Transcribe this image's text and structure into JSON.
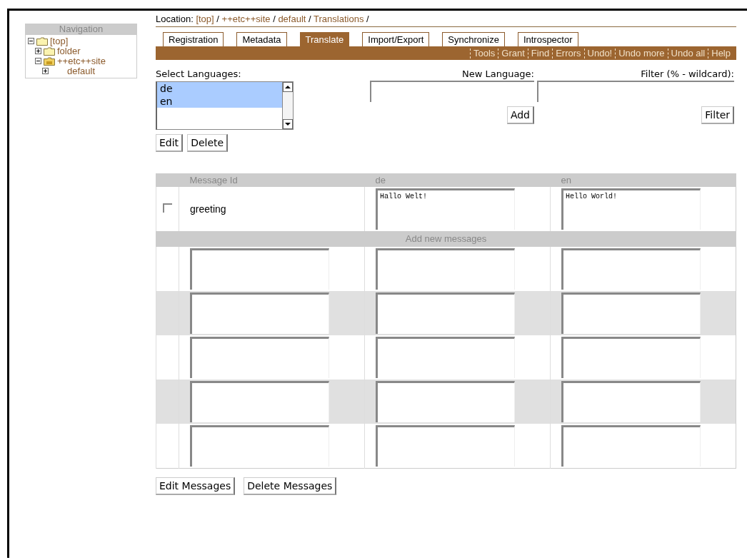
{
  "navigation": {
    "title": "Navigation",
    "tree": [
      {
        "label": "[top]",
        "kind": "folder",
        "expanded": true,
        "children": [
          {
            "label": "folder",
            "kind": "folder",
            "expanded": false
          },
          {
            "label": "++etc++site",
            "kind": "site",
            "expanded": true,
            "children": [
              {
                "label": "default",
                "expanded": false
              }
            ]
          }
        ]
      }
    ]
  },
  "location": {
    "label": "Location:",
    "crumbs": [
      {
        "kind": "link",
        "text": "[top]"
      },
      {
        "kind": "separator",
        "text": "/"
      },
      {
        "kind": "link",
        "text": "++etc++site"
      },
      {
        "kind": "separator",
        "text": "/"
      },
      {
        "kind": "link",
        "text": "default"
      },
      {
        "kind": "separator",
        "text": "/"
      },
      {
        "kind": "link",
        "text": "Translations"
      },
      {
        "kind": "separator",
        "text": "/"
      }
    ]
  },
  "tabs": [
    {
      "label": "Registration",
      "selected": false
    },
    {
      "label": "Metadata",
      "selected": false
    },
    {
      "label": "Translate",
      "selected": true
    },
    {
      "label": "Import/Export",
      "selected": false
    },
    {
      "label": "Synchronize",
      "selected": false
    },
    {
      "label": "Introspector",
      "selected": false
    }
  ],
  "actions": [
    "Tools",
    "Grant",
    "Find",
    "Errors",
    "Undo!",
    "Undo more",
    "Undo all",
    "Help"
  ],
  "select_languages": {
    "label": "Select Languages:",
    "options": [
      {
        "label": "de",
        "selected": true
      },
      {
        "label": "en",
        "selected": true
      }
    ],
    "buttons": [
      "Edit",
      "Delete"
    ]
  },
  "new_language": {
    "label": "New Language:",
    "button": "Add"
  },
  "filter": {
    "label": "Filter (% - wildcard):",
    "button": "Filter"
  },
  "table": {
    "columns": [
      "Message Id",
      "de",
      "en"
    ],
    "rows": [
      {
        "id": "greeting",
        "checked": false,
        "values": [
          "Hallo Welt!",
          "Hello World!"
        ]
      }
    ],
    "add_heading": "Add new messages",
    "new_rows": [
      {
        "shaded": false
      },
      {
        "shaded": true
      },
      {
        "shaded": false
      },
      {
        "shaded": true
      },
      {
        "shaded": false
      }
    ]
  },
  "buttons": [
    "Edit Messages",
    "Delete Messages"
  ]
}
